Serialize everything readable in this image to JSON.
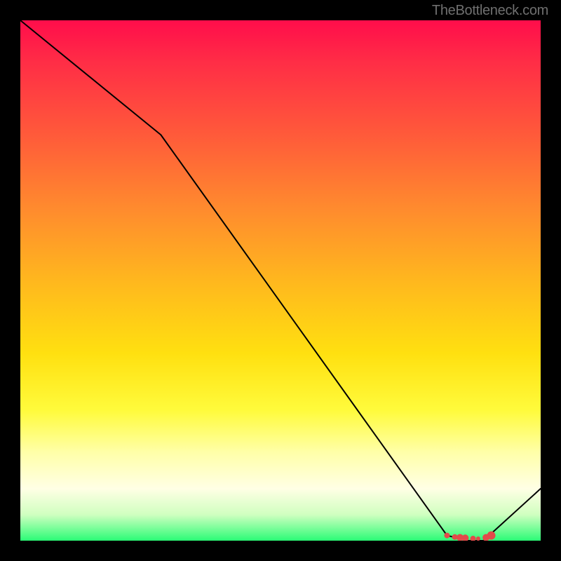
{
  "branding": {
    "watermark": "TheBottleneck.com"
  },
  "chart_data": {
    "type": "line",
    "title": "",
    "xlabel": "",
    "ylabel": "",
    "xlim": [
      0,
      100
    ],
    "ylim": [
      0,
      100
    ],
    "grid": false,
    "legend": false,
    "x": [
      0,
      27,
      82,
      86,
      89,
      100
    ],
    "values": [
      100,
      78,
      1,
      0,
      0,
      10
    ],
    "line_color": "#000000",
    "line_width": 2,
    "markers": [
      {
        "x": 82,
        "y": 1,
        "color": "#e24a4a",
        "size": 4
      },
      {
        "x": 83.5,
        "y": 0.7,
        "color": "#e24a4a",
        "size": 4
      },
      {
        "x": 84.5,
        "y": 0.6,
        "color": "#e24a4a",
        "size": 5
      },
      {
        "x": 85.5,
        "y": 0.5,
        "color": "#e24a4a",
        "size": 5
      },
      {
        "x": 87,
        "y": 0.4,
        "color": "#e24a4a",
        "size": 4
      },
      {
        "x": 88,
        "y": 0.4,
        "color": "#e24a4a",
        "size": 3
      },
      {
        "x": 89.5,
        "y": 0.6,
        "color": "#e24a4a",
        "size": 5
      },
      {
        "x": 90.5,
        "y": 1.0,
        "color": "#e24a4a",
        "size": 6
      }
    ]
  }
}
